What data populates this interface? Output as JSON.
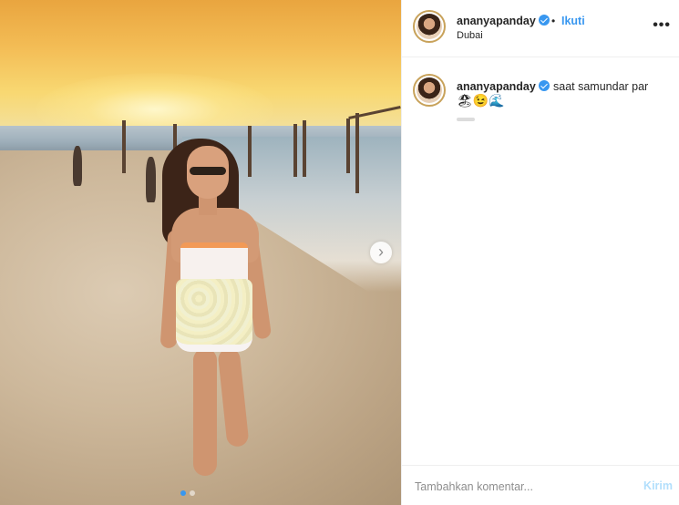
{
  "post": {
    "username": "ananyapanday",
    "verified": true,
    "follow_label": "Ikuti",
    "bullet": "•",
    "location": "Dubai",
    "more_label": "•••"
  },
  "caption": {
    "username": "ananyapanday",
    "text": "saat samundar par",
    "emojis": "🏖😉🌊"
  },
  "carousel": {
    "next_icon": "chevron-right-icon",
    "next_glyph": "›",
    "dots": 2,
    "active_dot": 0
  },
  "comment": {
    "placeholder": "Tambahkan komentar...",
    "send_label": "Kirim"
  },
  "colors": {
    "accent": "#3897f0",
    "send_disabled": "#b2dffc",
    "text": "#262626",
    "muted": "#8e8e8e"
  }
}
